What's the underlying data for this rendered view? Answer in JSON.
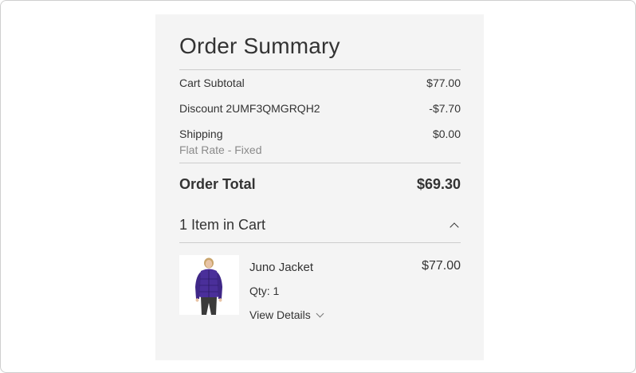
{
  "summary": {
    "title": "Order Summary",
    "subtotal": {
      "label": "Cart Subtotal",
      "value": "$77.00"
    },
    "discount": {
      "label": "Discount 2UMF3QMGRQH2",
      "value": "-$7.70"
    },
    "shipping": {
      "label": "Shipping",
      "method": "Flat Rate - Fixed",
      "value": "$0.00"
    },
    "total": {
      "label": "Order Total",
      "value": "$69.30"
    }
  },
  "cart": {
    "header": "1 Item in Cart",
    "toggle_icon": "chevron-up-icon",
    "item": {
      "name": "Juno Jacket",
      "price": "$77.00",
      "qty": "Qty: 1",
      "details_label": "View Details",
      "details_icon": "chevron-down-icon",
      "jacket_color": "#4a2f9a"
    }
  }
}
